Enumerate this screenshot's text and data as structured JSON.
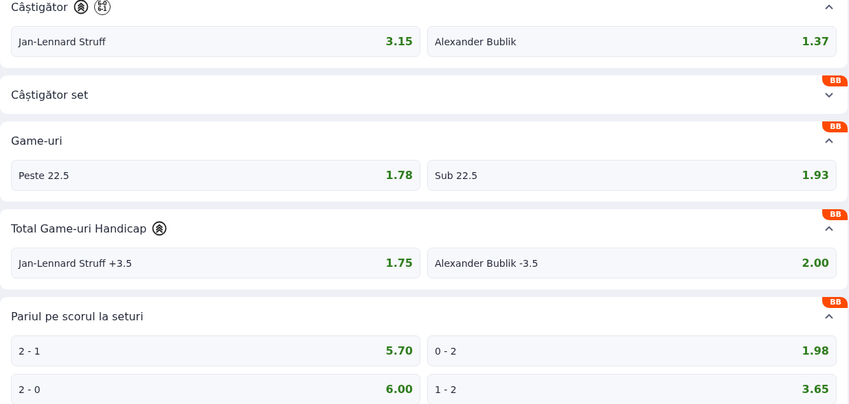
{
  "markets": [
    {
      "title": "Câștigător",
      "expanded": true,
      "icons": [
        {
          "kind": "boost"
        },
        {
          "kind": "score",
          "lines": [
            "6-0",
            "6-1"
          ]
        }
      ],
      "options": [
        {
          "label": "Jan-Lennard Struff",
          "odds": "3.15"
        },
        {
          "label": "Alexander Bublik",
          "odds": "1.37"
        }
      ]
    },
    {
      "title": "Câștigător set",
      "expanded": false,
      "badge": "BB"
    },
    {
      "title": "Game-uri",
      "expanded": true,
      "badge": "BB",
      "options": [
        {
          "label": "Peste 22.5",
          "odds": "1.78"
        },
        {
          "label": "Sub 22.5",
          "odds": "1.93"
        }
      ]
    },
    {
      "title": "Total Game-uri Handicap",
      "expanded": true,
      "badge": "BB",
      "icons": [
        {
          "kind": "boost"
        }
      ],
      "options": [
        {
          "label": "Jan-Lennard Struff +3.5",
          "odds": "1.75"
        },
        {
          "label": "Alexander Bublik -3.5",
          "odds": "2.00"
        }
      ]
    },
    {
      "title": "Pariul pe scorul la seturi",
      "expanded": true,
      "badge": "BB",
      "options": [
        {
          "label": "2 - 1",
          "odds": "5.70"
        },
        {
          "label": "0 - 2",
          "odds": "1.98"
        },
        {
          "label": "2 - 0",
          "odds": "6.00"
        },
        {
          "label": "1 - 2",
          "odds": "3.65"
        }
      ]
    }
  ]
}
